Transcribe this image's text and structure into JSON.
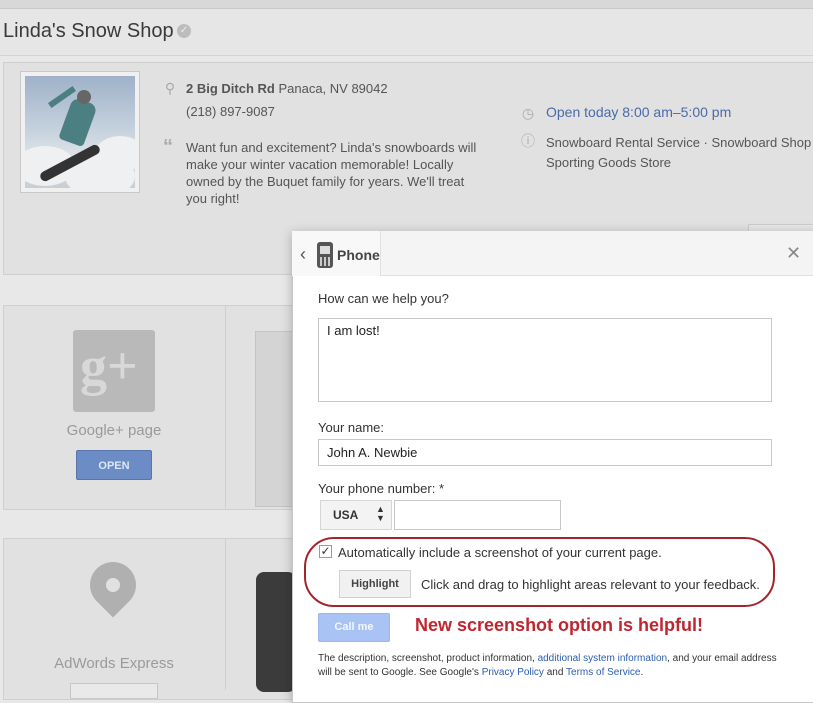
{
  "shop": {
    "title": "Linda's Snow Shop",
    "address_street": "2 Big Ditch Rd",
    "address_city": "Panaca, NV 89042",
    "phone": "(218) 897-9087",
    "description_lines": [
      "Want fun and excitement? Linda's snowboards will",
      "make your winter vacation memorable! Locally",
      "owned by the Buquet family for years. We'll treat",
      "you right!"
    ],
    "hours": "Open today 8:00 am–5:00 pm",
    "categories_line1": "Snowboard Rental Service · Snowboard Shop ·",
    "categories_line2": "Sporting Goods Store"
  },
  "cards": {
    "gplus_label": "Google+ page",
    "gplus_button": "OPEN",
    "adwords_label": "AdWords Express"
  },
  "dialog": {
    "tab_label": "Phone",
    "help_label": "How can we help you?",
    "help_value": "I am lost!",
    "name_label": "Your name:",
    "name_value": "John A. Newbie",
    "phone_label": "Your phone number: *",
    "country_value": "USA",
    "phone_value": "",
    "screenshot_label": "Automatically include a screenshot of your current page.",
    "screenshot_checked": true,
    "highlight_button": "Highlight",
    "highlight_hint": "Click and drag to highlight areas relevant to your feedback.",
    "call_button": "Call me",
    "annotation": "New screenshot option is helpful!",
    "footer": {
      "part1": "The description, screenshot, product information,",
      "link_system": "additional system information",
      "part2": ", and your email address will be sent to Google. See Google's",
      "link_privacy": "Privacy Policy",
      "part3": "and",
      "link_terms": "Terms of Service",
      "part4": "."
    }
  },
  "colors": {
    "link_blue": "#2a5db0",
    "annotation_red": "#c0262f",
    "call_button": "#a9c3f5"
  }
}
